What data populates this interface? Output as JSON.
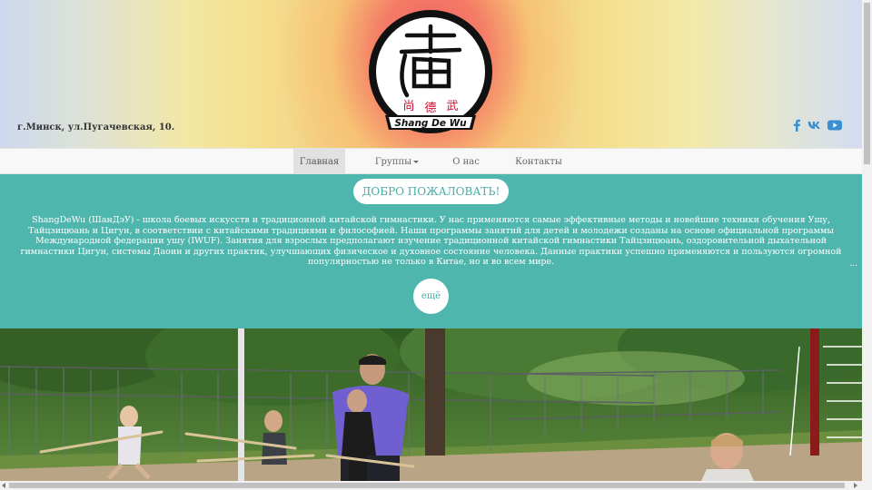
{
  "header": {
    "address": "г.Минск, ул.Пугачевская, 10.",
    "logo": {
      "caption": "Shang De Wu",
      "chars": [
        "尚",
        "德",
        "武"
      ]
    },
    "social": [
      {
        "name": "facebook-icon",
        "glyph": "f"
      },
      {
        "name": "vk-icon",
        "glyph": "vk"
      },
      {
        "name": "youtube-icon",
        "glyph": "▶"
      }
    ]
  },
  "nav": {
    "items": [
      {
        "label": "Главная",
        "active": true
      },
      {
        "label": "Группы",
        "dropdown": true
      },
      {
        "label": "О нас"
      },
      {
        "label": "Контакты"
      }
    ]
  },
  "welcome": {
    "title": "ДОБРО ПОЖАЛОВАТЬ!",
    "text": "ShangDeWu (ШанДэУ) - школа боевых искусств и традиционной китайской гимнастики. У нас применяются самые эффективные методы и новейшие техники обучения Ушу, Тайцзицюань и Цигун, в соответствии с китайскими традициями и философией. Наши программы занятий для детей и молодежи созданы на основе официальной программы Международной федерации ушу (IWUF). Занятия для взрослых предполагают изучение традиционной китайской гимнастики Тайцзицюань, оздоровительной дыхательной гимнастики Цигун, системы Даоин и других практик, улучшающих физическое и духовное состояние человека. Данные практики успешно применяются и пользуются огромной популярностью не только в Китае, но и во всем мире.",
    "ellipsis": "...",
    "more_label": "ещё"
  },
  "colors": {
    "teal": "#4fb6ae",
    "social_blue": "#3b8fd0",
    "nav_bg": "#f8f8f8"
  }
}
